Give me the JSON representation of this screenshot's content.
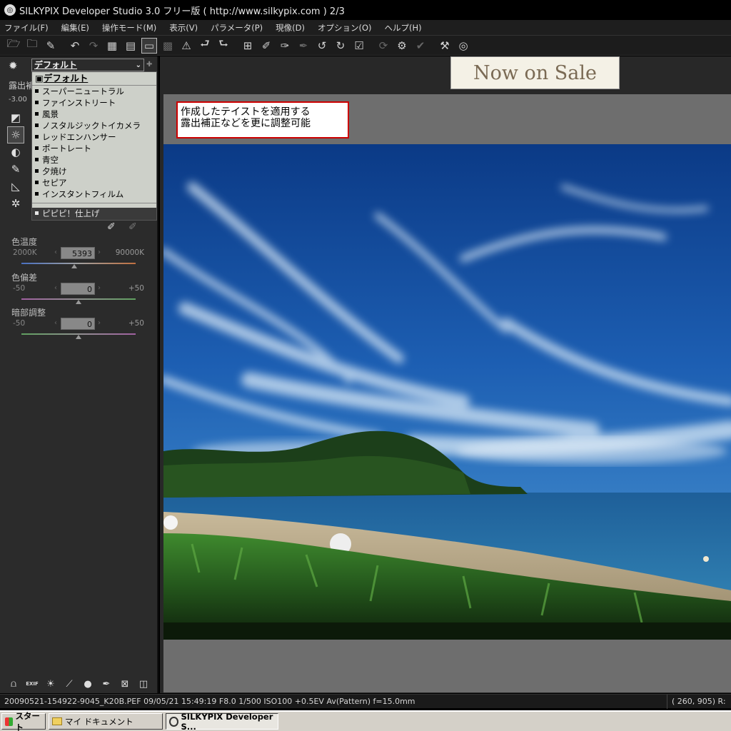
{
  "window": {
    "title": "SILKYPIX Developer Studio 3.0 フリー版 ( http://www.silkypix.com )  2/3"
  },
  "menu": [
    "ファイル(F)",
    "編集(E)",
    "操作モード(M)",
    "表示(V)",
    "パラメータ(P)",
    "現像(D)",
    "オプション(O)",
    "ヘルプ(H)"
  ],
  "toolbar": {
    "icons": [
      "open-folder-icon",
      "open-recent-icon",
      "eraser-icon",
      "undo-icon",
      "redo-icon",
      "grid-view-icon",
      "filmstrip-view-icon",
      "single-view-icon",
      "compare-view-icon",
      "warning-icon",
      "prev-image-icon",
      "next-image-icon",
      "crop-grid-icon",
      "eyedropper-icon",
      "paste-param-icon",
      "spot-tool-icon",
      "rotate-left-icon",
      "rotate-right-icon",
      "check-icon",
      "refresh-icon",
      "develop-settings-icon",
      "batch-check-icon",
      "hammer-icon",
      "silkypix-icon"
    ]
  },
  "left_panel": {
    "taste_select": "デフォルト",
    "exposure_label": "露出補",
    "exposure_min": "-3.00",
    "taste_dropdown": {
      "selected": "デフォルト",
      "items": [
        "スーパーニュートラル",
        "ファインストリート",
        "風景",
        "ノスタルジックトイカメラ",
        "レッドエンハンサー",
        "ポートレート",
        "青空",
        "夕焼け",
        "セピア",
        "インスタントフィルム"
      ],
      "bottom_item": "ピピピ！仕上げ"
    },
    "sliders": [
      {
        "label": "色温度",
        "min": "2000K",
        "max": "90000K",
        "value": "5393",
        "position": 0.46
      },
      {
        "label": "色偏差",
        "min": "-50",
        "max": "+50",
        "value": "0",
        "position": 0.5
      },
      {
        "label": "暗部調整",
        "min": "-50",
        "max": "+50",
        "value": "0",
        "position": 0.5
      }
    ],
    "bottom_icons": [
      "histogram-icon",
      "exif-icon",
      "exposure-icon",
      "tone-curve-icon",
      "sphere-icon",
      "brush-icon",
      "fit-icon",
      "film-icon"
    ],
    "exif_text": "EXIF"
  },
  "main": {
    "banner": "Now on Sale",
    "callout_line1": "作成したテイストを適用する",
    "callout_line2": "露出補正などを更に調整可能"
  },
  "status": {
    "info": "20090521-154922-9045_K20B.PEF 09/05/21 15:49:19 F8.0 1/500 ISO100 +0.5EV Av(Pattern) f=15.0mm",
    "coords": "( 260, 905) R:"
  },
  "taskbar": {
    "start": "スタート",
    "docs": "マイ ドキュメント",
    "active_app": "SILKYPIX Developer S..."
  }
}
